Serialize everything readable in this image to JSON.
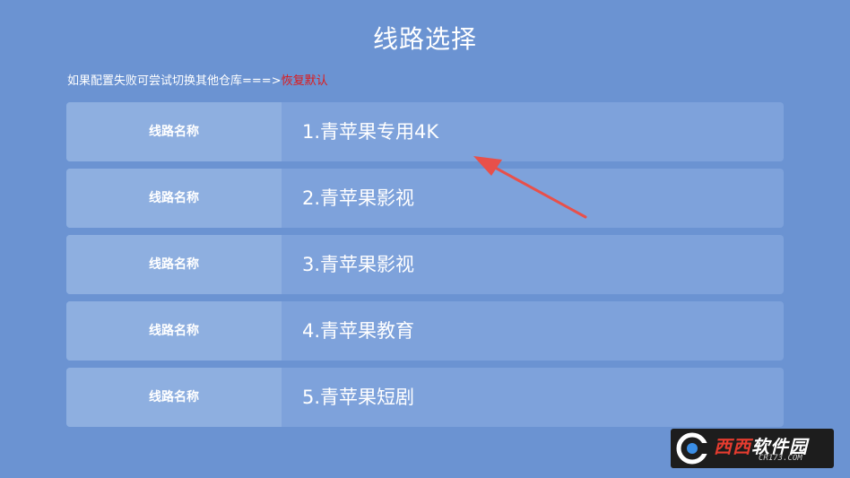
{
  "page": {
    "title": "线路选择",
    "hint_text": "如果配置失败可尝试切换其他仓库===>",
    "reset_label": "恢复默认"
  },
  "routes": [
    {
      "label": "线路名称",
      "name": "1.青苹果专用4K"
    },
    {
      "label": "线路名称",
      "name": "2.青苹果影视"
    },
    {
      "label": "线路名称",
      "name": "3.青苹果影视"
    },
    {
      "label": "线路名称",
      "name": "4.青苹果教育"
    },
    {
      "label": "线路名称",
      "name": "5.青苹果短剧"
    }
  ],
  "watermark": {
    "brand": "西西软件园",
    "brand_highlight": "西西",
    "brand_rest": "软件园",
    "site": "CR173.COM"
  },
  "colors": {
    "background": "#6b93d2",
    "row": "#7ea2db",
    "label_cell": "#8eafe0",
    "reset": "#e01818",
    "arrow": "#e8504a"
  }
}
